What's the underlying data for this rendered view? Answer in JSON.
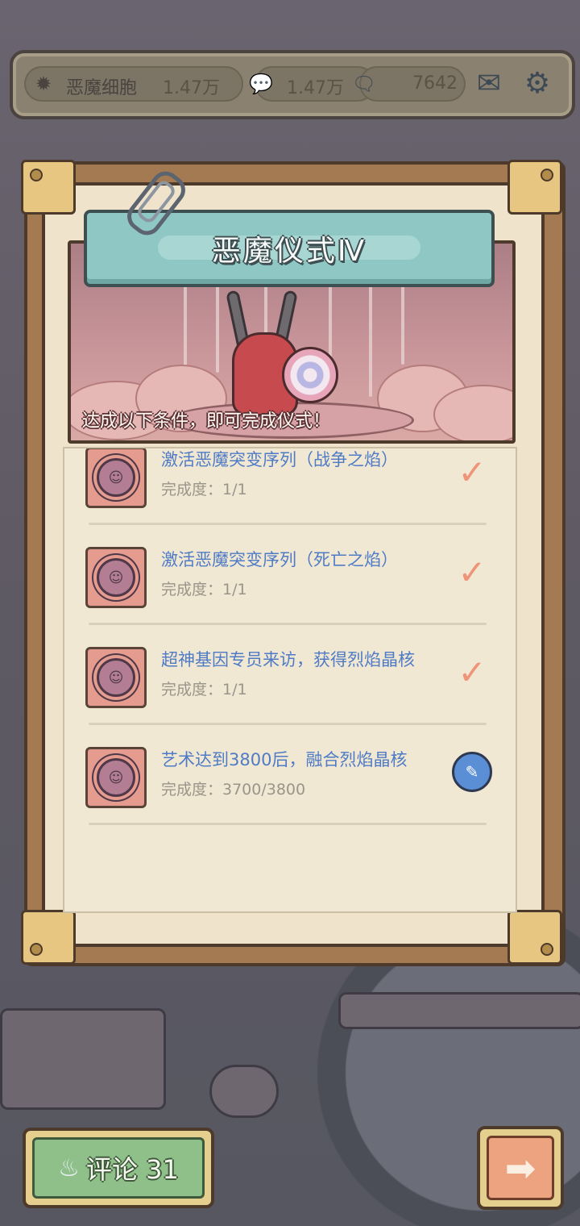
{
  "top_bar": {
    "resource1": {
      "label": "恶魔细胞",
      "value": "1.47万",
      "icon": "demon-cell-icon"
    },
    "resource2": {
      "value": "1.47万",
      "icon": "chat-bubble-icon"
    },
    "resource3": {
      "value": "7642",
      "icon": "speech-bubble-icon"
    },
    "mail_icon": "✉",
    "settings_icon": "⚙"
  },
  "panel": {
    "title": "恶魔仪式Ⅳ",
    "subtitle": "达成以下条件，即可完成仪式！"
  },
  "tasks": [
    {
      "title": "激活恶魔突变序列（战争之焰）",
      "progress": "完成度：1/1",
      "status": "done"
    },
    {
      "title": "激活恶魔突变序列（死亡之焰）",
      "progress": "完成度：1/1",
      "status": "done"
    },
    {
      "title": "超神基因专员来访，获得烈焰晶核",
      "progress": "完成度：1/1",
      "status": "done"
    },
    {
      "title": "艺术达到3800后，融合烈焰晶核",
      "progress": "完成度：3700/3800",
      "status": "in_progress"
    }
  ],
  "icons": {
    "check": "✓",
    "edit": "✎",
    "task_gear": "☺",
    "comment": "♨",
    "next": "➡"
  },
  "bottom": {
    "comment_label": "评论 31"
  },
  "colors": {
    "task_title": "#4f7bc6",
    "check": "#ef9478",
    "title_plate": "#8fc7c4",
    "comment_button": "#8fc08a",
    "next_button": "#eda37f"
  }
}
